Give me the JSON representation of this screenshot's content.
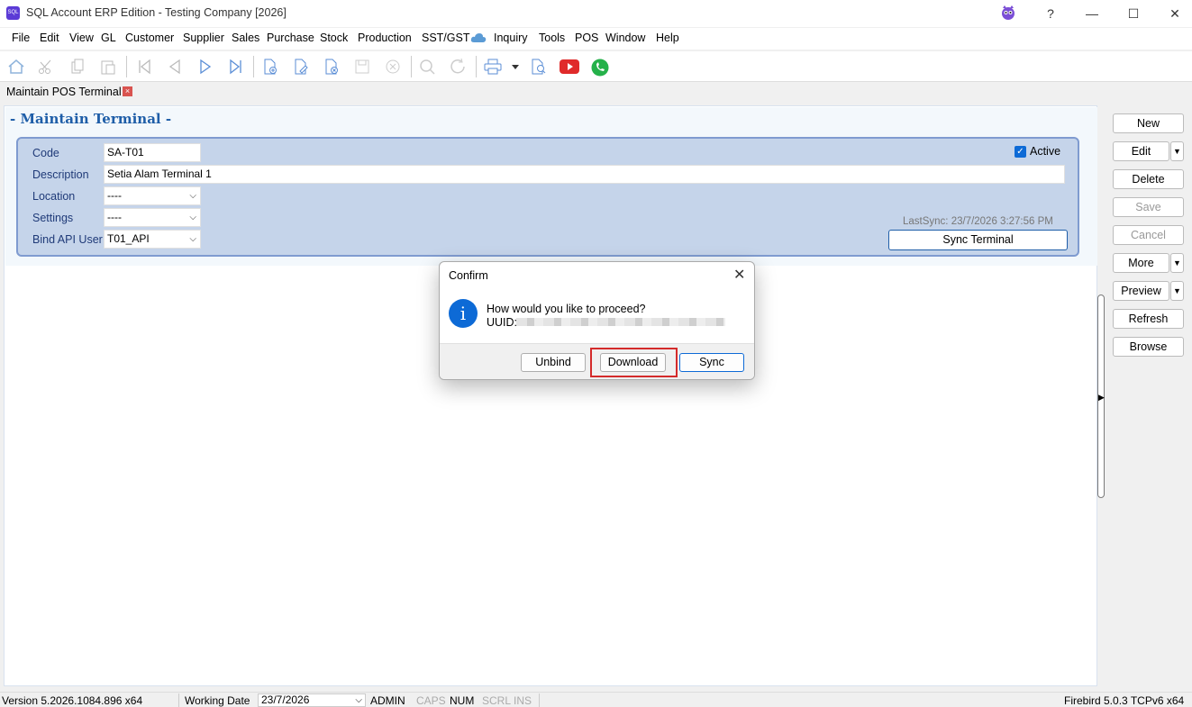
{
  "window": {
    "title": "SQL Account ERP Edition - Testing Company [2026]",
    "controls": {
      "help": "?",
      "minimize": "—",
      "maximize": "☐",
      "close": "✕"
    }
  },
  "menu": [
    "File",
    "Edit",
    "View",
    "GL",
    "Customer",
    "Supplier",
    "Sales",
    "Purchase",
    "Stock",
    "Production",
    "SST/GST",
    "Inquiry",
    "Tools",
    "POS",
    "Window",
    "Help"
  ],
  "tab": {
    "label": "Maintain POS Terminal",
    "close": "×"
  },
  "form": {
    "page_title": "- Maintain Terminal -",
    "code_label": "Code",
    "code_value": "SA-T01",
    "description_label": "Description",
    "description_value": "Setia Alam Terminal 1",
    "location_label": "Location",
    "location_value": "----",
    "settings_label": "Settings",
    "settings_value": "----",
    "bind_api_label": "Bind API User",
    "bind_api_value": "T01_API",
    "active_label": "Active",
    "active_checked": true,
    "last_sync": "LastSync: 23/7/2026 3:27:56 PM",
    "sync_button": "Sync Terminal"
  },
  "side_buttons": {
    "new": "New",
    "edit": "Edit",
    "delete": "Delete",
    "save": "Save",
    "cancel": "Cancel",
    "more": "More",
    "preview": "Preview",
    "refresh": "Refresh",
    "browse": "Browse"
  },
  "dialog": {
    "title": "Confirm",
    "message": "How would you like to proceed?",
    "uuid_label": "UUID:",
    "buttons": {
      "unbind": "Unbind",
      "download": "Download",
      "sync": "Sync"
    }
  },
  "status": {
    "version": "Version 5.2026.1084.896 x64",
    "working_date_label": "Working Date",
    "working_date_value": "23/7/2026",
    "user": "ADMIN",
    "caps": "CAPS",
    "num": "NUM",
    "scrl": "SCRL",
    "ins": "INS",
    "db": "Firebird 5.0.3 TCPv6 x64"
  },
  "colors": {
    "accent": "#1f5ea8",
    "panel": "#c5d4ea",
    "highlight": "#d42b2b"
  }
}
